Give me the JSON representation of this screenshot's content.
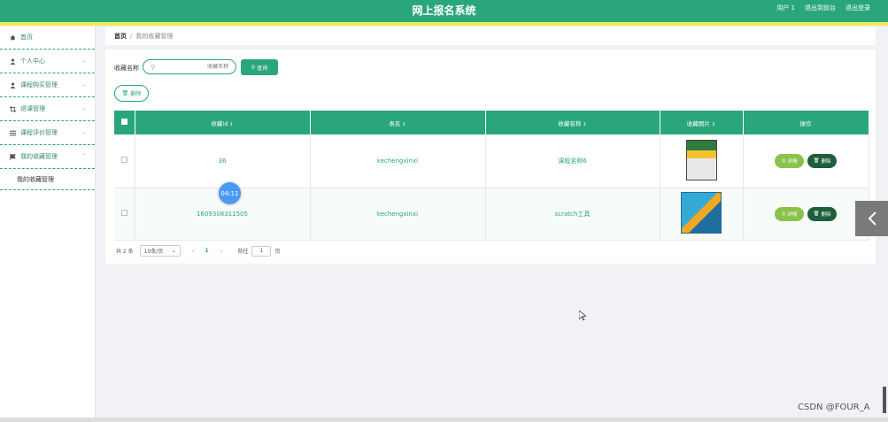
{
  "header": {
    "title": "网上报名系统",
    "links": [
      "用户 1",
      "退出到前台",
      "退出登录"
    ]
  },
  "sidebar": {
    "items": [
      {
        "label": "首页",
        "icon": "home-icon",
        "has_chevron": false
      },
      {
        "label": "个人中心",
        "icon": "user-icon",
        "has_chevron": true
      },
      {
        "label": "课程购买管理",
        "icon": "user-icon",
        "has_chevron": true
      },
      {
        "label": "退课管理",
        "icon": "crop-icon",
        "has_chevron": true
      },
      {
        "label": "课程评价管理",
        "icon": "list-icon",
        "has_chevron": true
      },
      {
        "label": "我的收藏管理",
        "icon": "flag-icon",
        "has_chevron": true,
        "expanded": true
      }
    ],
    "subitem": "我的收藏管理"
  },
  "breadcrumb": {
    "home": "首页",
    "sep": "/",
    "current": "我的收藏管理"
  },
  "search": {
    "label": "收藏名称",
    "placeholder": "收藏名称",
    "query_button": "查询"
  },
  "delete_button": "删除",
  "table": {
    "headers": [
      "收藏id",
      "表名",
      "收藏名称",
      "收藏图片",
      "操作"
    ],
    "rows": [
      {
        "id": "36",
        "table_name": "kechengxinxi",
        "name": "课程名称6"
      },
      {
        "id": "1609308311505",
        "table_name": "kechengxinxi",
        "name": "scratch工具"
      }
    ],
    "detail_button": "详情",
    "delete_button": "删除"
  },
  "pager": {
    "total": "共 2 条",
    "page_size": "10条/页",
    "current_page": "1",
    "goto_label": "前往",
    "goto_value": "1",
    "unit": "页"
  },
  "timer": "04:11",
  "watermark": "CSDN @FOUR_A",
  "colors": {
    "primary": "#2aa77a",
    "accent_yellow": "#f0e85a",
    "detail_green": "#8bc34a",
    "delete_dark": "#1e5e3a"
  }
}
